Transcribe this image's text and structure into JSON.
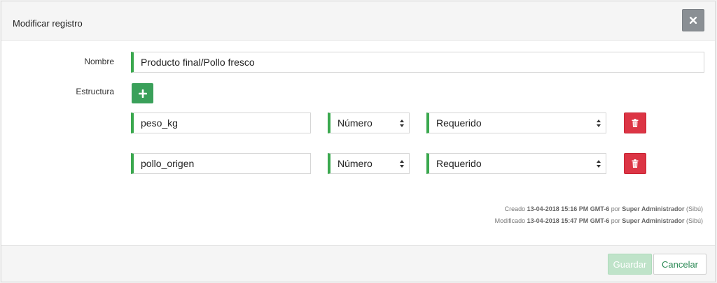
{
  "modal": {
    "title": "Modificar registro",
    "close_icon": "close-icon"
  },
  "form": {
    "nombre_label": "Nombre",
    "nombre_value": "Producto final/Pollo fresco",
    "estructura_label": "Estructura",
    "add_icon": "plus-icon",
    "rows": [
      {
        "name": "peso_kg",
        "type": "Número",
        "requirement": "Requerido",
        "delete_icon": "trash-icon"
      },
      {
        "name": "pollo_origen",
        "type": "Número",
        "requirement": "Requerido",
        "delete_icon": "trash-icon"
      }
    ]
  },
  "meta": {
    "created_prefix": "Creado",
    "created_date": "13-04-2018 15:16 PM GMT-6",
    "created_by_word": "por",
    "created_user": "Super Administrador",
    "created_org": "(Sibú)",
    "modified_prefix": "Modificado",
    "modified_date": "13-04-2018 15:47 PM GMT-6",
    "modified_by_word": "por",
    "modified_user": "Super Administrador",
    "modified_org": "(Sibú)"
  },
  "footer": {
    "save_label": "Guardar",
    "cancel_label": "Cancelar"
  },
  "colors": {
    "accent_green": "#3aa84e",
    "danger_red": "#dc3545",
    "close_gray": "#8a8f94"
  }
}
